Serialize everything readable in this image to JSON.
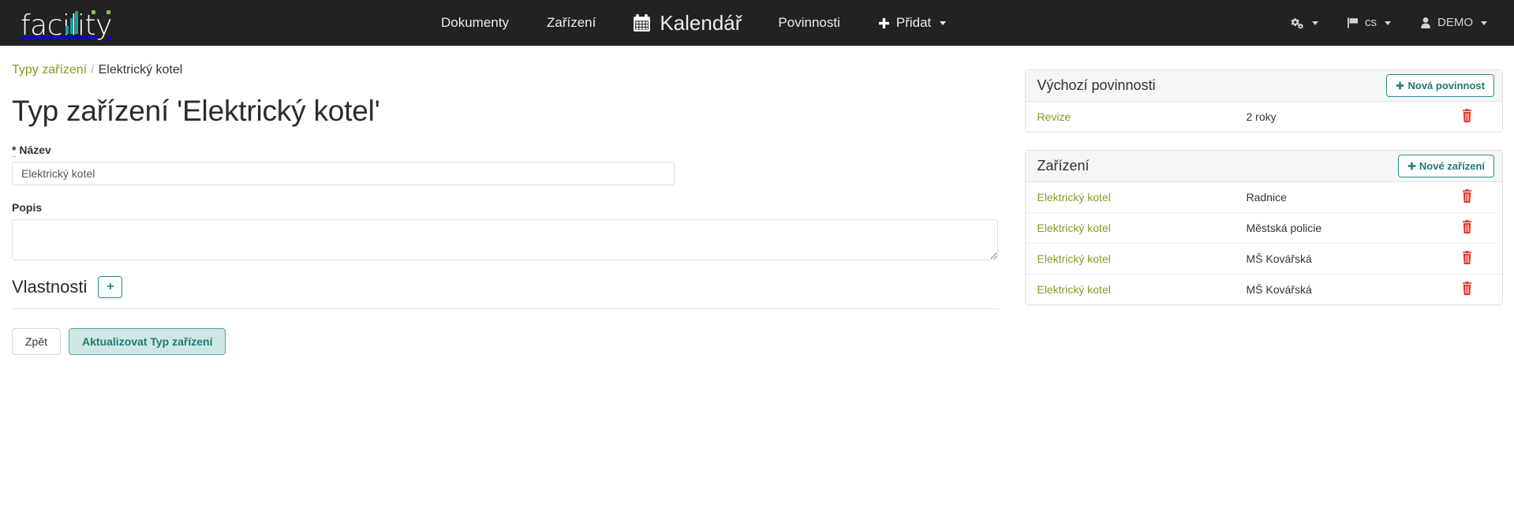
{
  "navbar": {
    "brand": "facility",
    "brand_icon": "bar-chart-logo-icon",
    "links": [
      {
        "label": "Dokumenty",
        "name": "nav-dokumenty"
      },
      {
        "label": "Zařízení",
        "name": "nav-zarizeni"
      },
      {
        "label": "Kalendář",
        "name": "nav-kalendar",
        "icon": "calendar-icon",
        "emphasis": true
      },
      {
        "label": "Povinnosti",
        "name": "nav-povinnosti"
      },
      {
        "label": "Přidat",
        "name": "nav-pridat",
        "icon": "plus-icon",
        "caret": true
      }
    ],
    "right": {
      "settings_icon": "gears-icon",
      "language_icon": "flag-icon",
      "language_label": "cs",
      "user_icon": "user-icon",
      "user_label": "DEMO"
    }
  },
  "breadcrumb": {
    "parent": "Typy zařízení",
    "separator": "/",
    "current": "Elektrický kotel"
  },
  "page": {
    "title": "Typ zařízení 'Elektrický kotel'"
  },
  "form": {
    "name_label_required": "*",
    "name_label": "Název",
    "name_value": "Elektrický kotel",
    "name_placeholder": "Název",
    "description_label": "Popis",
    "description_value": "",
    "description_placeholder": "",
    "properties_title": "Vlastnosti",
    "properties_add_label": "+",
    "back_label": "Zpět",
    "submit_label": "Aktualizovat Typ zařízení"
  },
  "panels": [
    {
      "name": "default-duties-panel",
      "title": "Výchozí povinnosti",
      "action_label": "Nová povinnost",
      "action_icon": "plus-icon",
      "rows": [
        {
          "name": "Revize",
          "value": "2 roky",
          "delete_icon": "trash-icon"
        }
      ]
    },
    {
      "name": "devices-panel",
      "title": "Zařízení",
      "action_label": "Nové zařízení",
      "action_icon": "plus-icon",
      "rows": [
        {
          "name": "Elektrický kotel",
          "value": "Radnice",
          "delete_icon": "trash-icon"
        },
        {
          "name": "Elektrický kotel",
          "value": "Městská policie",
          "delete_icon": "trash-icon"
        },
        {
          "name": "Elektrický kotel",
          "value": "MŠ Kovářská",
          "delete_icon": "trash-icon"
        },
        {
          "name": "Elektrický kotel",
          "value": "MŠ Kovářská",
          "delete_icon": "trash-icon"
        }
      ]
    }
  ],
  "colors": {
    "navbar_bg": "#222222",
    "link_olive": "#8a9a28",
    "teal": "#1d7a74",
    "teal_soft_bg": "#cfe7e4",
    "danger": "#e02b20",
    "logo_teal": "#1b9e9e",
    "logo_green": "#8bc34a"
  }
}
